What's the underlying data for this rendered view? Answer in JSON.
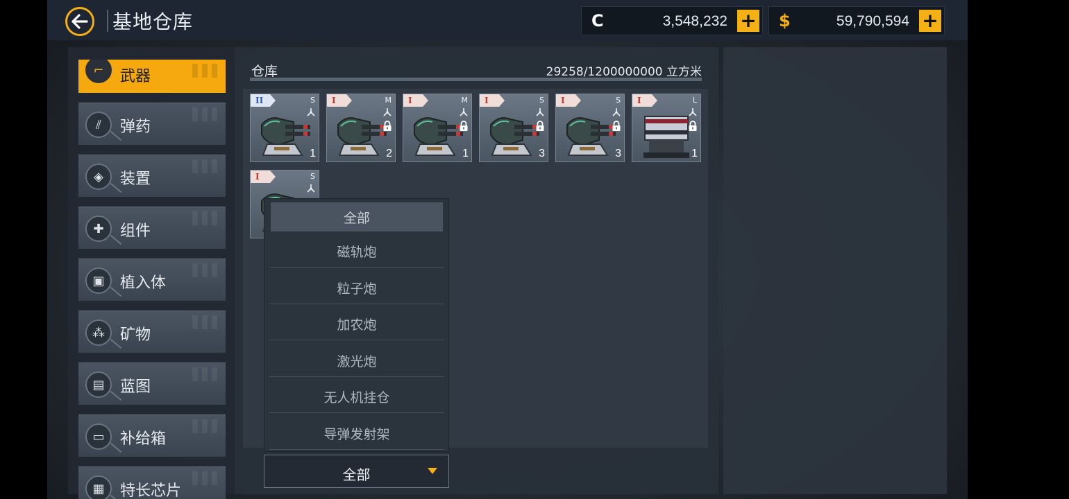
{
  "header": {
    "title": "基地仓库",
    "currencies": [
      {
        "icon": "C",
        "name": "credits",
        "value": "3,548,232",
        "color": "#ffffff"
      },
      {
        "icon": "$",
        "name": "money",
        "value": "59,790,594",
        "color": "#f5b014"
      }
    ],
    "plus_label": "+"
  },
  "categories": [
    {
      "label": "武器",
      "icon": "weapon-icon",
      "glyph": "⌐",
      "active": true
    },
    {
      "label": "弹药",
      "icon": "ammo-icon",
      "glyph": "⫽"
    },
    {
      "label": "装置",
      "icon": "device-icon",
      "glyph": "◈"
    },
    {
      "label": "组件",
      "icon": "component-icon",
      "glyph": "✚"
    },
    {
      "label": "植入体",
      "icon": "implant-icon",
      "glyph": "▣"
    },
    {
      "label": "矿物",
      "icon": "mineral-icon",
      "glyph": "⁂"
    },
    {
      "label": "蓝图",
      "icon": "blueprint-icon",
      "glyph": "▤"
    },
    {
      "label": "补给箱",
      "icon": "supply-box-icon",
      "glyph": "▭"
    },
    {
      "label": "特长芯片",
      "icon": "chip-icon",
      "glyph": "▦"
    }
  ],
  "storage": {
    "label": "仓库",
    "capacity": "29258/1200000000 立方米",
    "fill_fraction": 2.44e-05
  },
  "items": [
    {
      "tier": "II",
      "size": "S",
      "qty": "1",
      "locked": false
    },
    {
      "tier": "I",
      "size": "M",
      "qty": "2",
      "locked": true
    },
    {
      "tier": "I",
      "size": "M",
      "qty": "1",
      "locked": true
    },
    {
      "tier": "I",
      "size": "S",
      "qty": "3",
      "locked": true
    },
    {
      "tier": "I",
      "size": "S",
      "qty": "3",
      "locked": true
    },
    {
      "tier": "I",
      "size": "L",
      "qty": "1",
      "locked": true
    },
    {
      "tier": "I",
      "size": "S",
      "qty": "",
      "locked": false
    }
  ],
  "filter": {
    "selected": "全部",
    "options": [
      "全部",
      "磁轨炮",
      "粒子炮",
      "加农炮",
      "激光炮",
      "无人机挂仓",
      "导弹发射架"
    ]
  },
  "colors": {
    "accent": "#f5b014",
    "tier1": "#c0392b",
    "tier2": "#2d5cb8"
  }
}
